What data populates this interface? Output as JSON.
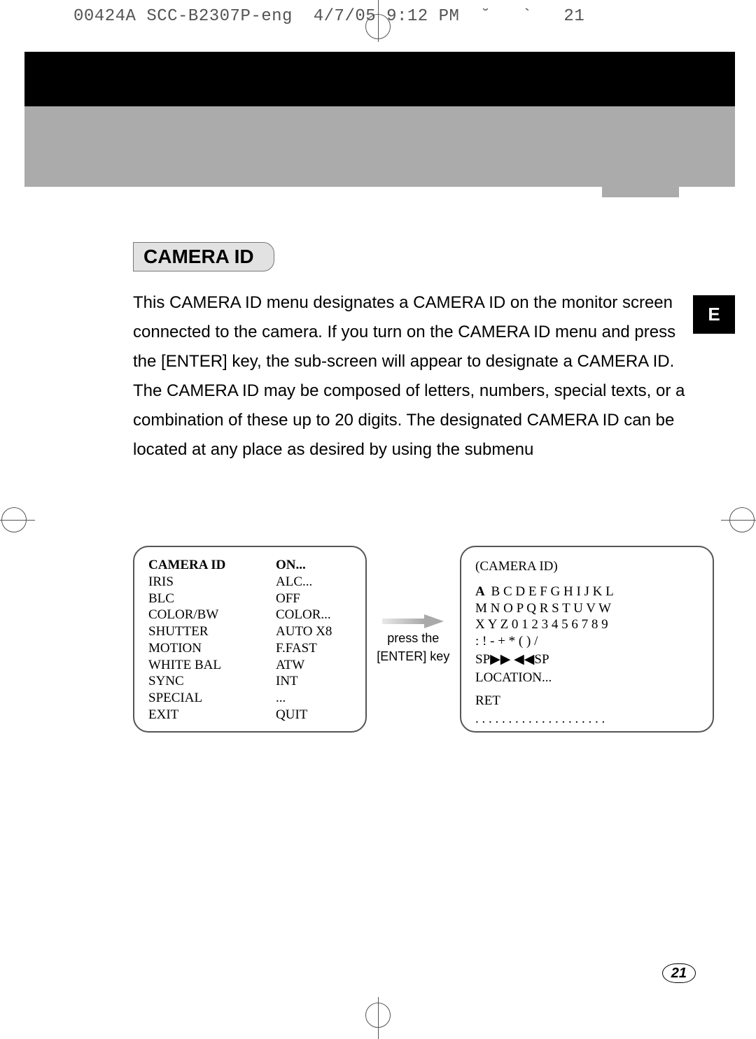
{
  "meta_header": "00424A SCC-B2307P-eng  4/7/05 9:12 PM  ˘   `   21",
  "lang_tab": "E",
  "heading": "CAMERA ID",
  "body_text": "This CAMERA ID menu designates a CAMERA ID on the monitor screen connected to the camera. If you turn on the CAMERA ID menu and press the [ENTER] key, the sub-screen will appear to designate a CAMERA ID. The CAMERA ID may be composed of letters, numbers,  special texts, or a combination of these up to 20 digits. The designated CAMERA ID can be located at any place as desired by using the submenu",
  "menu_left": [
    {
      "label": "CAMERA ID",
      "value": "ON...",
      "bold": true
    },
    {
      "label": "IRIS",
      "value": "ALC..."
    },
    {
      "label": "BLC",
      "value": "OFF"
    },
    {
      "label": "COLOR/BW",
      "value": "COLOR..."
    },
    {
      "label": "SHUTTER",
      "value": "AUTO X8"
    },
    {
      "label": "MOTION",
      "value": "F.FAST"
    },
    {
      "label": "WHITE BAL",
      "value": "ATW"
    },
    {
      "label": "SYNC",
      "value": "INT"
    },
    {
      "label": "SPECIAL",
      "value": "..."
    },
    {
      "label": "EXIT",
      "value": "QUIT"
    }
  ],
  "arrow_text_1": "press the",
  "arrow_text_2": "[ENTER] key",
  "panel_right": {
    "title": "(CAMERA ID)",
    "row1_first": "A",
    "row1_rest": " B C D E F G H I J K L",
    "row2": "M N O P Q R S T U V W",
    "row3": "X Y Z 0 1 2 3 4 5 6 7 8 9",
    "row4": ":  !  -  +  *  (  )  /",
    "sp_left": "SP",
    "sp_right": "SP",
    "location": "LOCATION...",
    "ret": "RET",
    "dots": ". . . . . . . . . . . . . . . . . . . ."
  },
  "page_number": "21"
}
